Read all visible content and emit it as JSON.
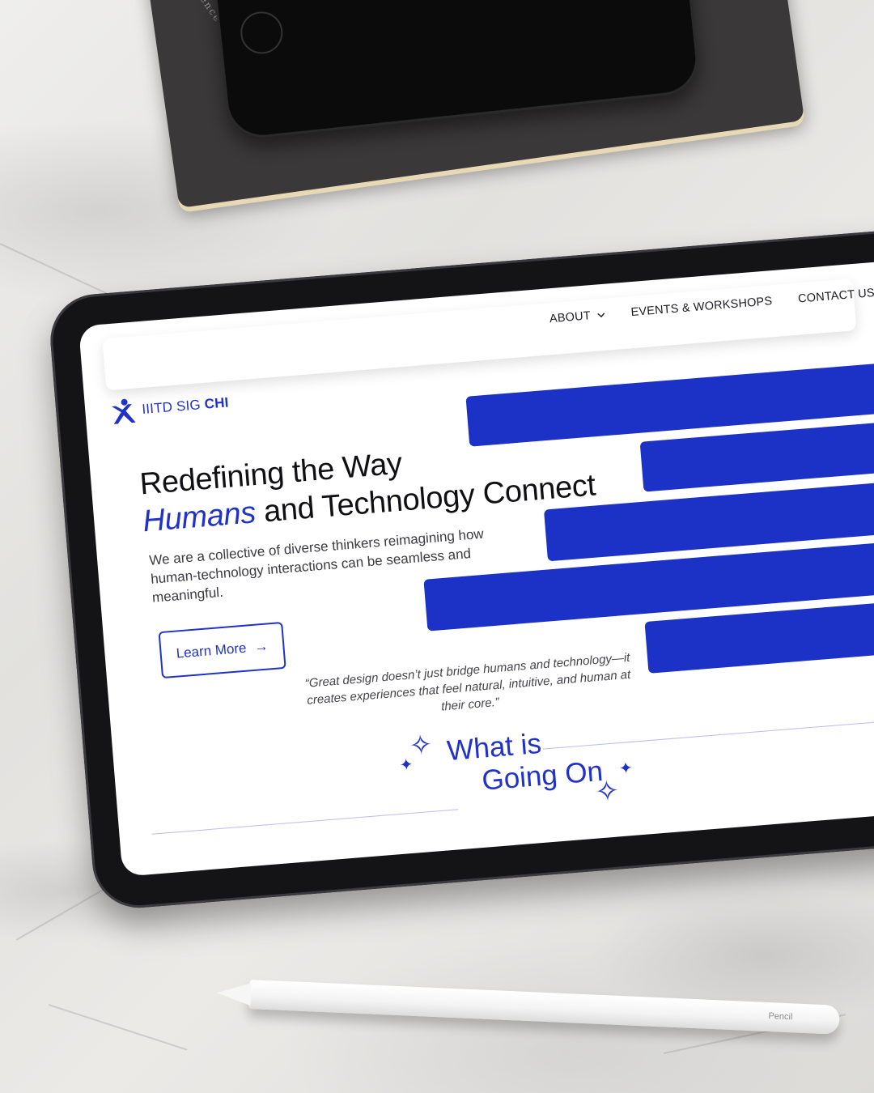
{
  "site": {
    "brand_prefix": "IIITD SIG",
    "brand_bold": "CHI",
    "nav": {
      "about": "ABOUT",
      "events": "EVENTS & WORKSHOPS",
      "contact": "CONTACT US"
    },
    "hero": {
      "title_line1": "Redefining the Way",
      "title_accent": "Humans",
      "title_line2_rest": " and Technology Connect",
      "description": "We are a collective of diverse thinkers reimagining how human-technology interactions can be seamless and meaningful.",
      "cta_label": "Learn More",
      "cta_arrow": "→"
    },
    "quote": "“Great design doesn’t just bridge humans and technology—it creates experiences that feel natural, intuitive, and human at their core.”",
    "section": {
      "line1": "What is",
      "line2": "Going On"
    }
  },
  "props": {
    "notebook_label": "silence",
    "pencil_label": "Pencil"
  },
  "colors": {
    "accent": "#1c32c6",
    "text": "#101014"
  },
  "icons": [
    "logo-icon",
    "chevron-down-icon",
    "arrow-right-icon",
    "sparkle-icon"
  ]
}
